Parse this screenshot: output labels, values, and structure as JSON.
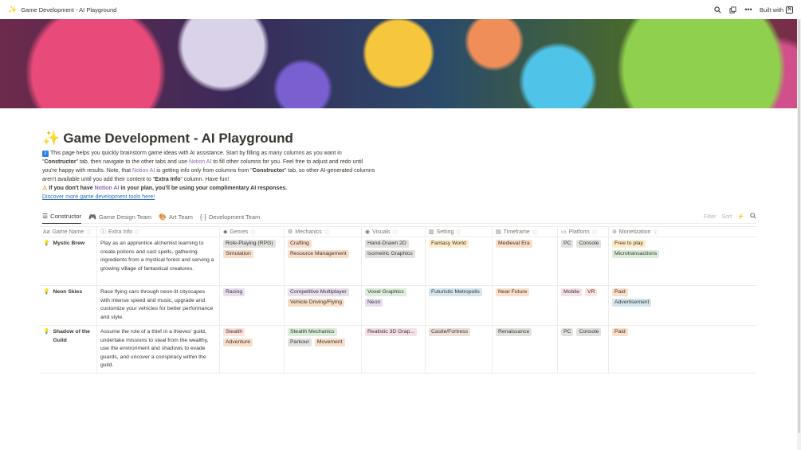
{
  "topbar": {
    "breadcrumb": "Game Development - AI Playground",
    "built_with": "Built with"
  },
  "page": {
    "title": "Game Development - AI Playground",
    "desc_p1": "This page helps you quickly brainstorm game ideas with AI assistance. Start by filling as many columns as you want in \"",
    "desc_constructor1": "Constructor",
    "desc_p2": "\" tab, then navigate to the other tabs and use ",
    "desc_notion_ai1": "Notion AI",
    "desc_p3": " to fill other columns for you. Feel free to adjust and redo until you're happy with results. Note, that ",
    "desc_notion_ai2": "Notion AI",
    "desc_p4": " is getting info only from columns from \"",
    "desc_constructor2": "Constructor",
    "desc_p5": "\" tab, so other AI-generated columns aren't available until you add their content to \"",
    "desc_extra": "Extra Info",
    "desc_p6": "\" column. Have fun!",
    "warn_p1": "If you don't have ",
    "warn_notion": "Notion AI",
    "warn_p2": " in your plan, you'll be using your complimentary AI responses.",
    "discover_link": "Discover more game development tools here!"
  },
  "tabs": [
    {
      "label": "Constructor"
    },
    {
      "label": "Game Design Team"
    },
    {
      "label": "Art Team"
    },
    {
      "label": "Development Team"
    }
  ],
  "tools": {
    "filter": "Filter",
    "sort": "Sort"
  },
  "columns": [
    "Game Name",
    "Extra Info",
    "Genres",
    "Mechanics",
    "Visuals",
    "Setting",
    "Timeframe",
    "Platform",
    "Monetization"
  ],
  "colors": {
    "gray": "#e3e2e0",
    "orange": "#fadec9",
    "yellow": "#fdecc8",
    "green": "#dbeddb",
    "purple": "#e8deee",
    "pink": "#f5e0e9",
    "red": "#ffe2dd",
    "blue": "#d3e5ef",
    "brown": "#eee0da"
  },
  "rows": [
    {
      "name": "Mystic Brew",
      "info": "Play as an apprentice alchemist learning to create potions and cast spells, gathering ingredients from a mystical forest and serving a growing village of fantastical creatures.",
      "genres": [
        {
          "t": "Role-Playing (RPG)",
          "c": "gray"
        },
        {
          "t": "Simulation",
          "c": "orange"
        }
      ],
      "mechanics": [
        {
          "t": "Crafting",
          "c": "orange"
        },
        {
          "t": "Resource Management",
          "c": "orange"
        }
      ],
      "visuals": [
        {
          "t": "Hand-Drawn 2D",
          "c": "gray"
        },
        {
          "t": "Isometric Graphics",
          "c": "gray"
        }
      ],
      "setting": [
        {
          "t": "Fantasy World",
          "c": "yellow"
        }
      ],
      "timeframe": [
        {
          "t": "Medieval Era",
          "c": "orange"
        }
      ],
      "platform": [
        {
          "t": "PC",
          "c": "gray"
        },
        {
          "t": "Console",
          "c": "gray"
        }
      ],
      "monetization": [
        {
          "t": "Free to play",
          "c": "yellow"
        },
        {
          "t": "Microtransactions",
          "c": "green"
        }
      ]
    },
    {
      "name": "Neon Skies",
      "info": "Race flying cars through neon-lit cityscapes with intense speed and music, upgrade and customize your vehicles for better performance and style.",
      "genres": [
        {
          "t": "Racing",
          "c": "purple"
        }
      ],
      "mechanics": [
        {
          "t": "Competitive Multiplayer",
          "c": "purple"
        },
        {
          "t": "Vehicle Driving/Flying",
          "c": "orange"
        }
      ],
      "visuals": [
        {
          "t": "Voxel Graphics",
          "c": "green"
        },
        {
          "t": "Neon",
          "c": "purple"
        }
      ],
      "setting": [
        {
          "t": "Futuristic Metropolis",
          "c": "blue"
        }
      ],
      "timeframe": [
        {
          "t": "Near Future",
          "c": "orange"
        }
      ],
      "platform": [
        {
          "t": "Mobile",
          "c": "pink"
        },
        {
          "t": "VR",
          "c": "red"
        }
      ],
      "monetization": [
        {
          "t": "Paid",
          "c": "orange"
        },
        {
          "t": "Advertisement",
          "c": "blue"
        }
      ]
    },
    {
      "name": "Shadow of the Guild",
      "info": "Assume the role of a thief in a thieves' guild, undertake missions to steal from the wealthy, use the environment and shadows to evade guards, and uncover a conspiracy within the guild.",
      "genres": [
        {
          "t": "Stealth",
          "c": "red"
        },
        {
          "t": "Adventure",
          "c": "orange"
        }
      ],
      "mechanics": [
        {
          "t": "Stealth Mechanics",
          "c": "green"
        },
        {
          "t": "Parkour",
          "c": "gray"
        },
        {
          "t": "Movement",
          "c": "orange"
        }
      ],
      "visuals": [
        {
          "t": "Realistic 3D Grap...",
          "c": "pink"
        }
      ],
      "setting": [
        {
          "t": "Castle/Fortress",
          "c": "brown"
        }
      ],
      "timeframe": [
        {
          "t": "Renaissance",
          "c": "gray"
        }
      ],
      "platform": [
        {
          "t": "PC",
          "c": "gray"
        },
        {
          "t": "Console",
          "c": "gray"
        }
      ],
      "monetization": [
        {
          "t": "Paid",
          "c": "orange"
        }
      ]
    }
  ]
}
